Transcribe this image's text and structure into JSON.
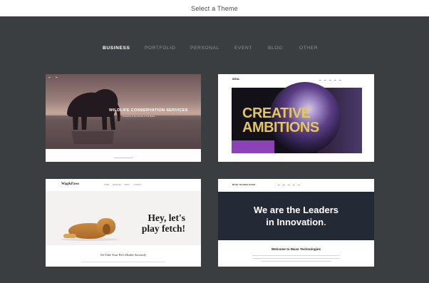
{
  "header": {
    "title": "Select a Theme"
  },
  "tabs": [
    {
      "label": "BUSINESS",
      "active": true
    },
    {
      "label": "PORTFOLIO",
      "active": false
    },
    {
      "label": "PERSONAL",
      "active": false
    },
    {
      "label": "EVENT",
      "active": false
    },
    {
      "label": "BLOG",
      "active": false
    },
    {
      "label": "OTHER",
      "active": false
    }
  ],
  "themes": [
    {
      "heading": "WILDLIFE CONSERVATION SERVICES",
      "subheading": "Dedicating to the Animals of Our Planet"
    },
    {
      "logo": "IDEAL",
      "headline_line1": "CREATIVE",
      "headline_line2": "AMBITIONS"
    },
    {
      "logo": "Wag&Paws",
      "nav": "HOME   SERVICES   ABOUT   CONTACT",
      "headline": "Hey, let's play fetch!",
      "tagline": "We Take Your Pet's Health Seriously"
    },
    {
      "logo": "MUSE TECHNOLOGIES",
      "headline_line1": "We are the Leaders",
      "headline_line2_main": "in Innovation",
      "headline_line2_accent": ".",
      "welcome": "Welcome to Muse Technologies"
    }
  ],
  "colors": {
    "background": "#3b3e41",
    "active_tab": "#ffffff",
    "inactive_tab": "#8e9296",
    "innovation_accent": "#f2b632",
    "creative_text": "#e3c75a"
  }
}
